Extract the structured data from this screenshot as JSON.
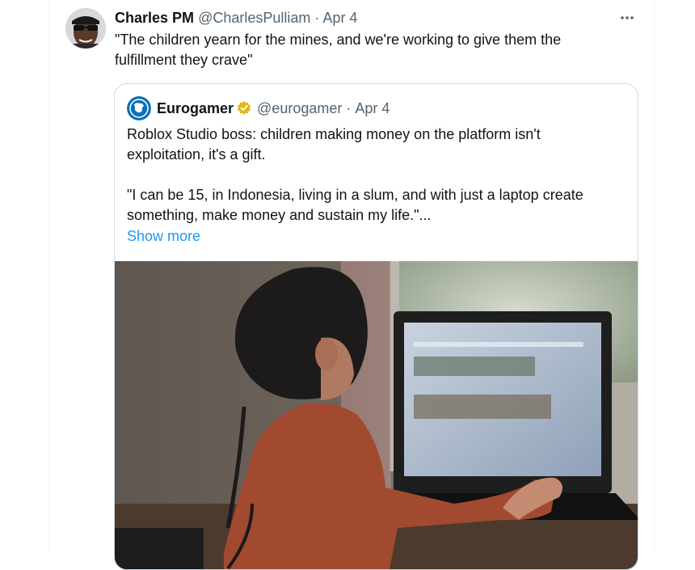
{
  "tweet": {
    "author_name": "Charles PM",
    "author_handle": "@CharlesPulliam",
    "separator": "·",
    "date": "Apr 4",
    "text": "\"The children yearn for the mines, and we're working to give them the\nfulfillment they crave\"",
    "more_icon": "more-horizontal-icon"
  },
  "quoted_tweet": {
    "author_name": "Eurogamer",
    "author_handle": "@eurogamer",
    "separator": "·",
    "date": "Apr 4",
    "verified_icon": "verified-badge-icon",
    "verified_color": "#e2b719",
    "text": "Roblox Studio boss: children making money on the platform isn't\nexploitation, it's a gift.\n\n\"I can be 15, in Indonesia, living in a slum, and with just a laptop create\nsomething, make money and sustain my life.\"...",
    "show_more_label": "Show more",
    "media_alt": "Child using a laptop"
  },
  "colors": {
    "link": "#1d9bf0",
    "secondary_text": "#536471",
    "border": "#cfd9de"
  }
}
